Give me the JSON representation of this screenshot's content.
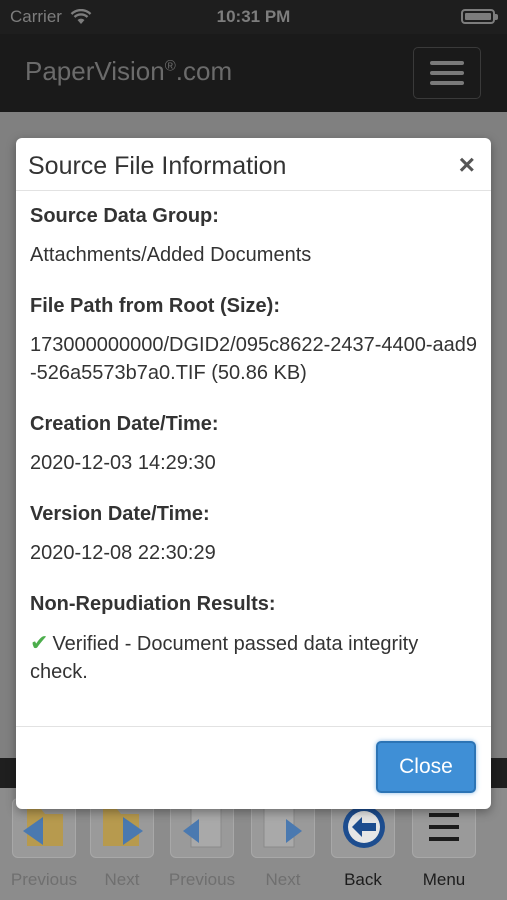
{
  "status_bar": {
    "carrier": "Carrier",
    "time": "10:31 PM"
  },
  "navbar": {
    "brand": "PaperVision",
    "brand_mark": "®",
    "brand_suffix": ".com",
    "menu_icon": "hamburger-icon"
  },
  "modal": {
    "title": "Source File Information",
    "close_x": "×",
    "sections": [
      {
        "label": "Source Data Group:",
        "value": "Attachments/Added Documents"
      },
      {
        "label": "File Path from Root (Size):",
        "value": "173000000000/DGID2/095c8622-2437-4400-aad9-526a5573b7a0.TIF (50.86 KB)"
      },
      {
        "label": "Creation Date/Time:",
        "value": "2020-12-03 14:29:30"
      },
      {
        "label": "Version Date/Time:",
        "value": "2020-12-08 22:30:29"
      },
      {
        "label": "Non-Repudiation Results:",
        "value": "Verified - Document passed data integrity check.",
        "icon": "checkmark-icon"
      }
    ],
    "close_button": "Close"
  },
  "toolbar": {
    "items": [
      {
        "label": "Previous",
        "icon": "previous-folder-icon"
      },
      {
        "label": "Next",
        "icon": "next-folder-icon"
      },
      {
        "label": "Previous",
        "icon": "previous-page-icon"
      },
      {
        "label": "Next",
        "icon": "next-page-icon"
      },
      {
        "label": "Back",
        "icon": "back-arrow-icon"
      },
      {
        "label": "Menu",
        "icon": "menu-icon"
      }
    ]
  },
  "colors": {
    "accent": "#3f8fd6",
    "success": "#4cae4c",
    "navbar": "#1a1a1a"
  }
}
